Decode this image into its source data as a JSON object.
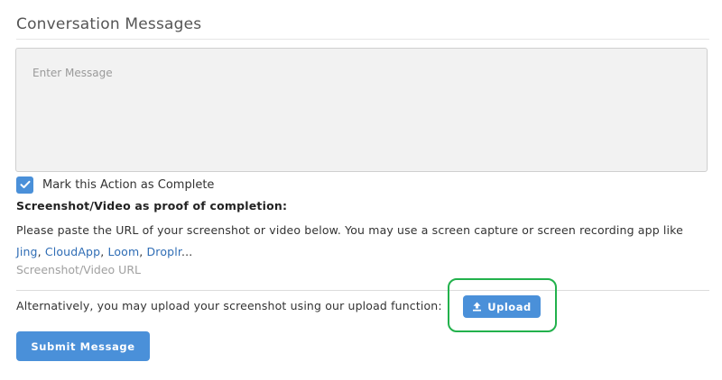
{
  "header": {
    "title": "Conversation Messages"
  },
  "message": {
    "placeholder": "Enter Message",
    "value": ""
  },
  "complete_checkbox": {
    "label": "Mark this Action as Complete",
    "checked": true
  },
  "proof": {
    "heading": "Screenshot/Video as proof of completion:",
    "instructions_prefix": "Please paste the URL of your screenshot or video below. You may use a screen capture or screen recording app like",
    "apps": [
      "Jing",
      "CloudApp",
      "Loom",
      "Droplr"
    ],
    "sep": ", ",
    "ellipsis": "...",
    "url_placeholder": "Screenshot/Video URL"
  },
  "upload": {
    "alt_text": "Alternatively, you may upload your screenshot using our upload function:",
    "button_label": "Upload",
    "button_icon": "upload-icon",
    "highlight_color": "#22b14c"
  },
  "submit": {
    "label": "Submit Message"
  },
  "colors": {
    "accent": "#4a90d9",
    "link": "#2f6db5"
  }
}
